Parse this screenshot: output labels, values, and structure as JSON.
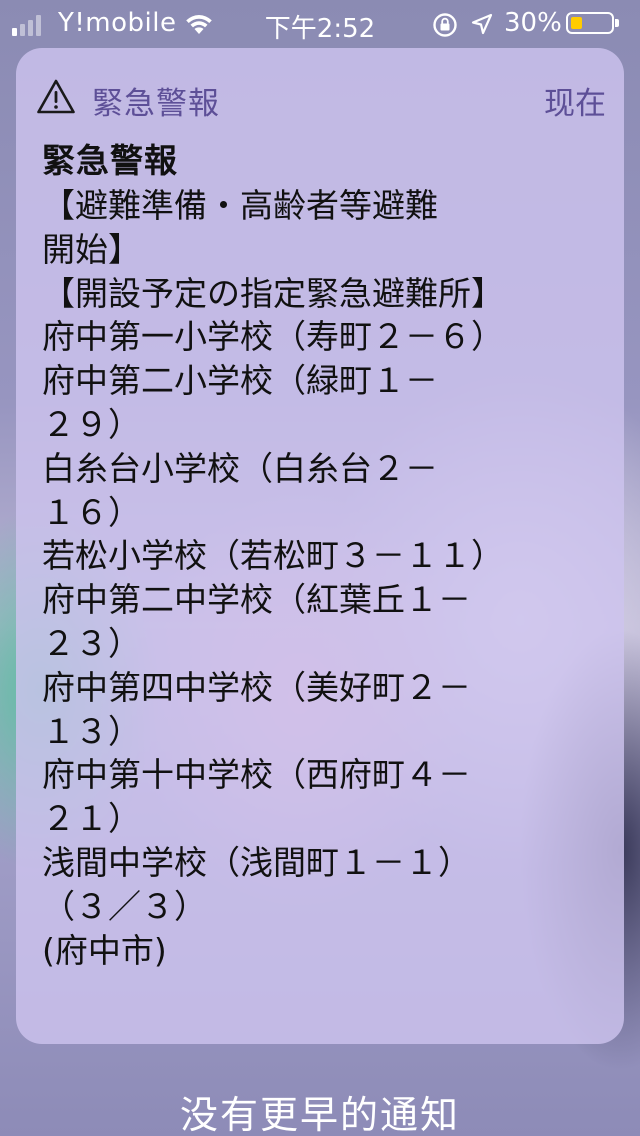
{
  "status_bar": {
    "carrier": "Y!mobile",
    "time": "下午2:52",
    "battery_percent": "30%",
    "battery_level": 0.3,
    "signal_bars_filled": 1,
    "signal_bars_total": 4,
    "battery_color": "#ffcc00"
  },
  "notification": {
    "app_name": "緊急警報",
    "timestamp": "现在",
    "title": "緊急警報",
    "lines": [
      "【避難準備・高齢者等避難",
      "開始】",
      "【開設予定の指定緊急避難所】",
      "府中第一小学校（寿町２－６）",
      "府中第二小学校（緑町１－",
      "２９）",
      "白糸台小学校（白糸台２－",
      "１６）",
      "若松小学校（若松町３－１１）",
      "府中第二中学校（紅葉丘１－",
      "２３）",
      "府中第四中学校（美好町２－",
      "１３）",
      "府中第十中学校（西府町４－",
      "２１）",
      "浅間中学校（浅間町１－１）",
      "（３／３）",
      "(府中市)"
    ],
    "accent_color": "#5d4f97"
  },
  "footer": {
    "no_older_text": "没有更早的通知"
  }
}
